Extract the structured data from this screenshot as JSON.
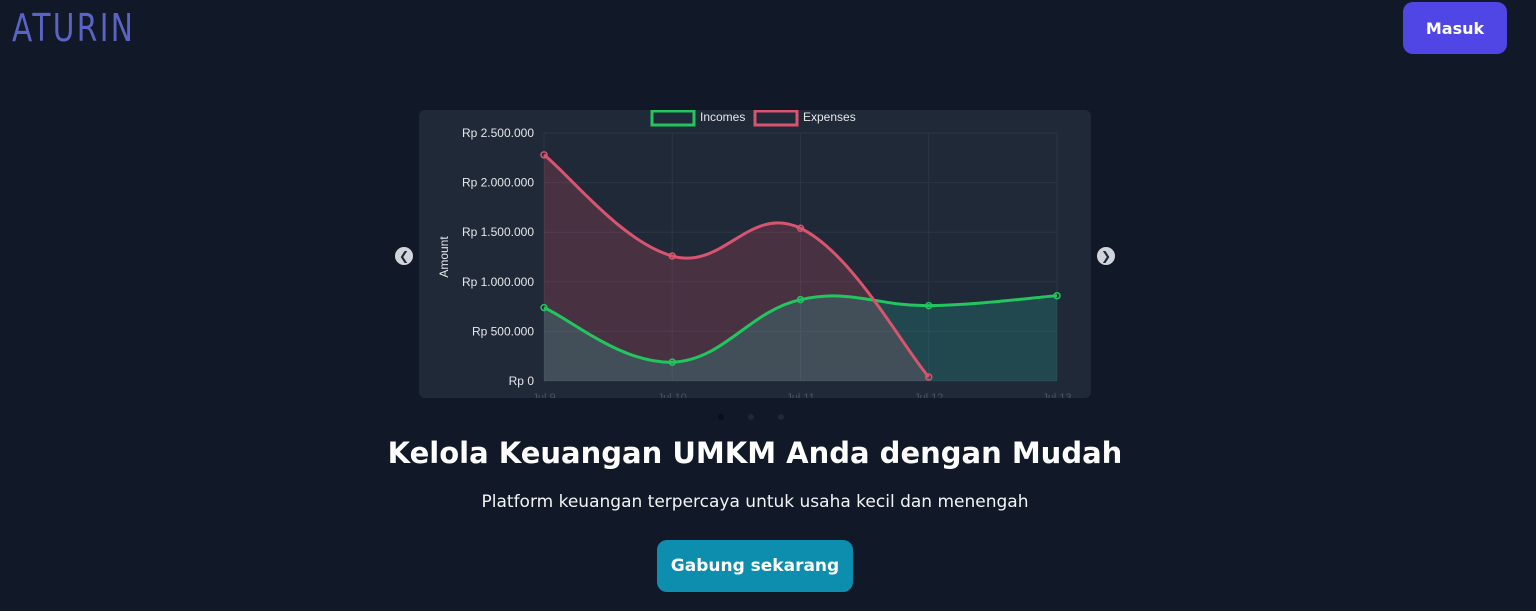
{
  "header": {
    "logo": "ATURIN",
    "login_label": "Masuk"
  },
  "carousel": {
    "prev_icon": "chevron-left-icon",
    "next_icon": "chevron-right-icon",
    "dot_count": 3,
    "active_dot": 0
  },
  "chart_data": {
    "type": "line",
    "categories": [
      "Jul 9",
      "Jul 10",
      "Jul 11",
      "Jul 12",
      "Jul 13"
    ],
    "ylabel": "Amount",
    "ylim": [
      0,
      2500000
    ],
    "yticks": [
      "Rp 0",
      "Rp 500.000",
      "Rp 1.000.000",
      "Rp 1.500.000",
      "Rp 2.000.000",
      "Rp 2.500.000"
    ],
    "legend_position": "top",
    "grid": true,
    "series": [
      {
        "name": "Incomes",
        "values": [
          740000,
          190000,
          820000,
          760000,
          860000
        ],
        "color": "#22c55e"
      },
      {
        "name": "Expenses",
        "values": [
          2280000,
          1260000,
          1540000,
          40000,
          null
        ],
        "color": "#d9546e"
      }
    ]
  },
  "hero": {
    "title": "Kelola Keuangan UMKM Anda dengan Mudah",
    "subtitle": "Platform keuangan terpercaya untuk usaha kecil dan menengah",
    "cta_label": "Gabung sekarang"
  }
}
